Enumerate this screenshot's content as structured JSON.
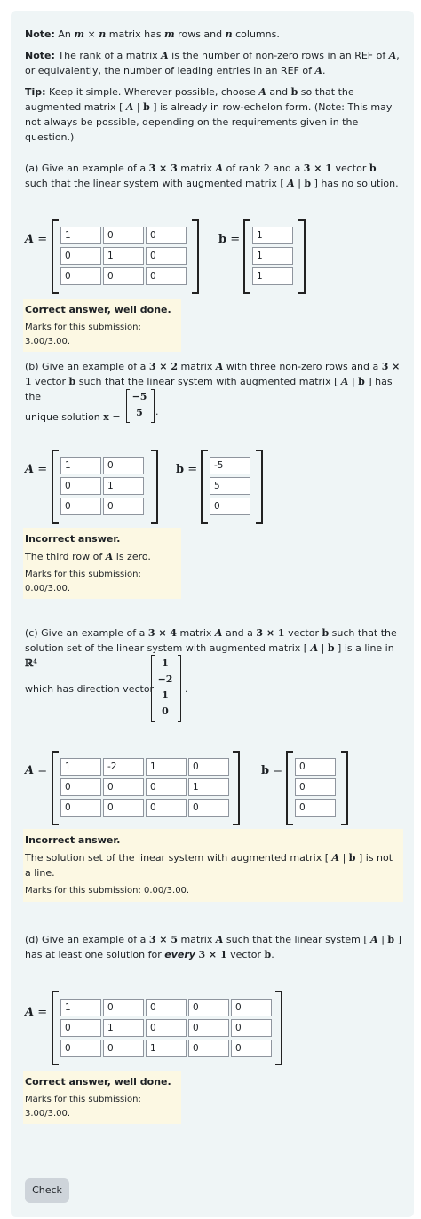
{
  "intro": {
    "note1_label": "Note:",
    "note1_text": " An m × n matrix has m rows and n columns.",
    "note2_label": "Note:",
    "note2_text": " The rank of a matrix A is the number of non-zero rows in an REF of A, or equivalently, the number of leading entries in an REF of A.",
    "tip_label": "Tip:",
    "tip_text": "  Keep it simple. Wherever possible, choose A and b so that the augmented matrix [ A | b ] is already in row-echelon form.  (Note: This may not always be possible, depending on the requirements given in the question.)"
  },
  "qa": {
    "text": "(a) Give an example of a 3 × 3 matrix A of rank 2 and a 3 × 1 vector b such that the linear system with augmented matrix [ A | b ] has no solution.",
    "A": [
      [
        "1",
        "0",
        "0"
      ],
      [
        "0",
        "1",
        "0"
      ],
      [
        "0",
        "0",
        "0"
      ]
    ],
    "b": [
      "1",
      "1",
      "1"
    ],
    "fb_head": "Correct answer, well done.",
    "fb_marks": "Marks for this submission: 3.00/3.00."
  },
  "qb": {
    "text": "(b) Give an example of a 3 × 2 matrix A with three non-zero rows and a 3 × 1 vector b such that the linear system with augmented matrix [ A | b ] has the unique solution x =",
    "solution": [
      "−5",
      "5"
    ],
    "A": [
      [
        "1",
        "0"
      ],
      [
        "0",
        "1"
      ],
      [
        "0",
        "0"
      ]
    ],
    "b": [
      "-5",
      "5",
      "0"
    ],
    "fb_head": "Incorrect answer.",
    "fb_text": "The third row of A is zero.",
    "fb_marks": "Marks for this submission: 0.00/3.00."
  },
  "qc": {
    "text": "(c) Give an example of a 3 × 4 matrix A and a 3 × 1 vector b such that the solution set of the linear system with augmented matrix [ A | b ] is a line in ℝ⁴",
    "dir_label": "which has direction vector",
    "direction": [
      "1",
      "−2",
      "1",
      "0"
    ],
    "A": [
      [
        "1",
        "-2",
        "1",
        "0"
      ],
      [
        "0",
        "0",
        "0",
        "1"
      ],
      [
        "0",
        "0",
        "0",
        "0"
      ]
    ],
    "b": [
      "0",
      "0",
      "0"
    ],
    "fb_head": "Incorrect answer.",
    "fb_text": "The solution set of the linear system with augmented matrix [ A | b ] is not a line.",
    "fb_marks": "Marks for this submission: 0.00/3.00."
  },
  "qd": {
    "text": "(d) Give an example of a 3 × 5  matrix A such that the linear system  [ A | b ] has at least one solution for every 3 × 1 vector b.",
    "A": [
      [
        "1",
        "0",
        "0",
        "0",
        "0"
      ],
      [
        "0",
        "1",
        "0",
        "0",
        "0"
      ],
      [
        "0",
        "0",
        "1",
        "0",
        "0"
      ]
    ],
    "fb_head": "Correct answer, well done.",
    "fb_marks": "Marks for this submission: 3.00/3.00."
  },
  "labels": {
    "A_eq": "A =",
    "b_eq": "b =",
    "period": "."
  },
  "check_button": "Check"
}
